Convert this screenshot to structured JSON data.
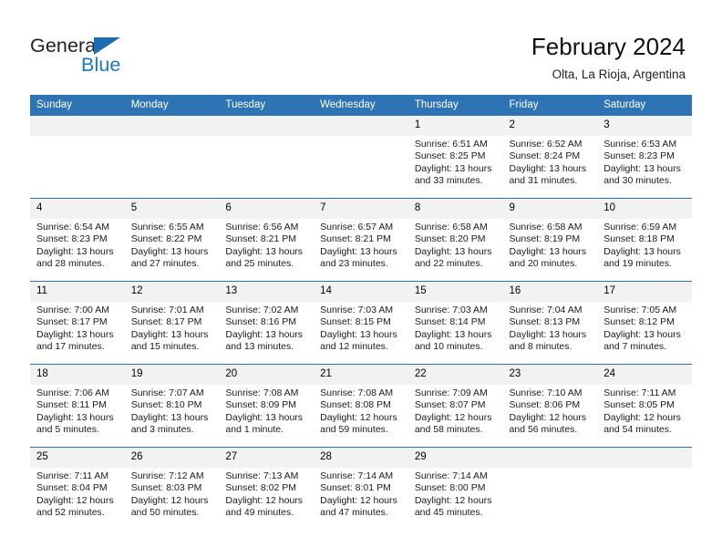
{
  "brand": {
    "name_part1": "General",
    "name_part2": "Blue",
    "triangle_color": "#1a6eb5",
    "blue_color": "#1a7ac4"
  },
  "header": {
    "title": "February 2024",
    "location": "Olta, La Rioja, Argentina"
  },
  "theme": {
    "header_bg": "#2e74b5",
    "daynum_bg": "#f2f2f2",
    "cell_bg": "#ffffff",
    "separator": "#2e74b5"
  },
  "weekdays": [
    "Sunday",
    "Monday",
    "Tuesday",
    "Wednesday",
    "Thursday",
    "Friday",
    "Saturday"
  ],
  "weeks": [
    [
      {
        "day": "",
        "blank": true
      },
      {
        "day": "",
        "blank": true
      },
      {
        "day": "",
        "blank": true
      },
      {
        "day": "",
        "blank": true
      },
      {
        "day": "1",
        "sunrise": "Sunrise: 6:51 AM",
        "sunset": "Sunset: 8:25 PM",
        "daylight": "Daylight: 13 hours and 33 minutes."
      },
      {
        "day": "2",
        "sunrise": "Sunrise: 6:52 AM",
        "sunset": "Sunset: 8:24 PM",
        "daylight": "Daylight: 13 hours and 31 minutes."
      },
      {
        "day": "3",
        "sunrise": "Sunrise: 6:53 AM",
        "sunset": "Sunset: 8:23 PM",
        "daylight": "Daylight: 13 hours and 30 minutes."
      }
    ],
    [
      {
        "day": "4",
        "sunrise": "Sunrise: 6:54 AM",
        "sunset": "Sunset: 8:23 PM",
        "daylight": "Daylight: 13 hours and 28 minutes."
      },
      {
        "day": "5",
        "sunrise": "Sunrise: 6:55 AM",
        "sunset": "Sunset: 8:22 PM",
        "daylight": "Daylight: 13 hours and 27 minutes."
      },
      {
        "day": "6",
        "sunrise": "Sunrise: 6:56 AM",
        "sunset": "Sunset: 8:21 PM",
        "daylight": "Daylight: 13 hours and 25 minutes."
      },
      {
        "day": "7",
        "sunrise": "Sunrise: 6:57 AM",
        "sunset": "Sunset: 8:21 PM",
        "daylight": "Daylight: 13 hours and 23 minutes."
      },
      {
        "day": "8",
        "sunrise": "Sunrise: 6:58 AM",
        "sunset": "Sunset: 8:20 PM",
        "daylight": "Daylight: 13 hours and 22 minutes."
      },
      {
        "day": "9",
        "sunrise": "Sunrise: 6:58 AM",
        "sunset": "Sunset: 8:19 PM",
        "daylight": "Daylight: 13 hours and 20 minutes."
      },
      {
        "day": "10",
        "sunrise": "Sunrise: 6:59 AM",
        "sunset": "Sunset: 8:18 PM",
        "daylight": "Daylight: 13 hours and 19 minutes."
      }
    ],
    [
      {
        "day": "11",
        "sunrise": "Sunrise: 7:00 AM",
        "sunset": "Sunset: 8:17 PM",
        "daylight": "Daylight: 13 hours and 17 minutes."
      },
      {
        "day": "12",
        "sunrise": "Sunrise: 7:01 AM",
        "sunset": "Sunset: 8:17 PM",
        "daylight": "Daylight: 13 hours and 15 minutes."
      },
      {
        "day": "13",
        "sunrise": "Sunrise: 7:02 AM",
        "sunset": "Sunset: 8:16 PM",
        "daylight": "Daylight: 13 hours and 13 minutes."
      },
      {
        "day": "14",
        "sunrise": "Sunrise: 7:03 AM",
        "sunset": "Sunset: 8:15 PM",
        "daylight": "Daylight: 13 hours and 12 minutes."
      },
      {
        "day": "15",
        "sunrise": "Sunrise: 7:03 AM",
        "sunset": "Sunset: 8:14 PM",
        "daylight": "Daylight: 13 hours and 10 minutes."
      },
      {
        "day": "16",
        "sunrise": "Sunrise: 7:04 AM",
        "sunset": "Sunset: 8:13 PM",
        "daylight": "Daylight: 13 hours and 8 minutes."
      },
      {
        "day": "17",
        "sunrise": "Sunrise: 7:05 AM",
        "sunset": "Sunset: 8:12 PM",
        "daylight": "Daylight: 13 hours and 7 minutes."
      }
    ],
    [
      {
        "day": "18",
        "sunrise": "Sunrise: 7:06 AM",
        "sunset": "Sunset: 8:11 PM",
        "daylight": "Daylight: 13 hours and 5 minutes."
      },
      {
        "day": "19",
        "sunrise": "Sunrise: 7:07 AM",
        "sunset": "Sunset: 8:10 PM",
        "daylight": "Daylight: 13 hours and 3 minutes."
      },
      {
        "day": "20",
        "sunrise": "Sunrise: 7:08 AM",
        "sunset": "Sunset: 8:09 PM",
        "daylight": "Daylight: 13 hours and 1 minute."
      },
      {
        "day": "21",
        "sunrise": "Sunrise: 7:08 AM",
        "sunset": "Sunset: 8:08 PM",
        "daylight": "Daylight: 12 hours and 59 minutes."
      },
      {
        "day": "22",
        "sunrise": "Sunrise: 7:09 AM",
        "sunset": "Sunset: 8:07 PM",
        "daylight": "Daylight: 12 hours and 58 minutes."
      },
      {
        "day": "23",
        "sunrise": "Sunrise: 7:10 AM",
        "sunset": "Sunset: 8:06 PM",
        "daylight": "Daylight: 12 hours and 56 minutes."
      },
      {
        "day": "24",
        "sunrise": "Sunrise: 7:11 AM",
        "sunset": "Sunset: 8:05 PM",
        "daylight": "Daylight: 12 hours and 54 minutes."
      }
    ],
    [
      {
        "day": "25",
        "sunrise": "Sunrise: 7:11 AM",
        "sunset": "Sunset: 8:04 PM",
        "daylight": "Daylight: 12 hours and 52 minutes."
      },
      {
        "day": "26",
        "sunrise": "Sunrise: 7:12 AM",
        "sunset": "Sunset: 8:03 PM",
        "daylight": "Daylight: 12 hours and 50 minutes."
      },
      {
        "day": "27",
        "sunrise": "Sunrise: 7:13 AM",
        "sunset": "Sunset: 8:02 PM",
        "daylight": "Daylight: 12 hours and 49 minutes."
      },
      {
        "day": "28",
        "sunrise": "Sunrise: 7:14 AM",
        "sunset": "Sunset: 8:01 PM",
        "daylight": "Daylight: 12 hours and 47 minutes."
      },
      {
        "day": "29",
        "sunrise": "Sunrise: 7:14 AM",
        "sunset": "Sunset: 8:00 PM",
        "daylight": "Daylight: 12 hours and 45 minutes."
      },
      {
        "day": "",
        "blank": true
      },
      {
        "day": "",
        "blank": true
      }
    ]
  ]
}
